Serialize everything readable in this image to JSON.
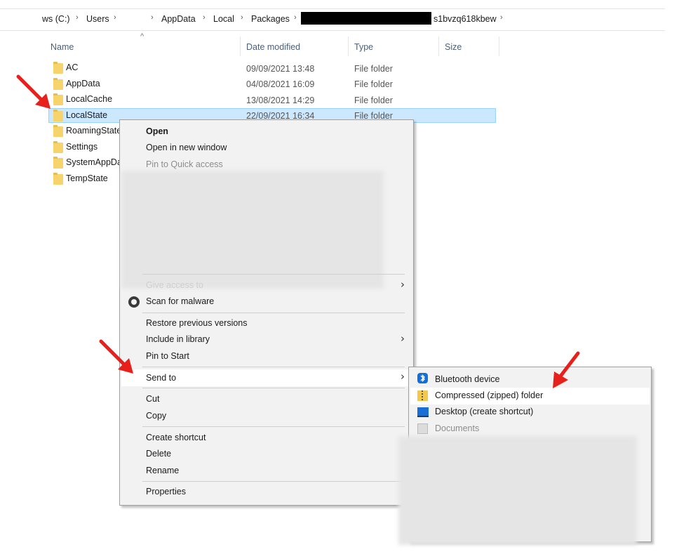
{
  "breadcrumb": {
    "items": [
      "ws (C:)",
      "Users",
      "AppData",
      "Local",
      "Packages",
      "s1bvzq618kbew"
    ],
    "separator": "›",
    "redacted_segment": true
  },
  "columns": {
    "name": "Name",
    "date_modified": "Date modified",
    "type": "Type",
    "size": "Size"
  },
  "files": [
    {
      "name": "AC",
      "date": "09/09/2021 13:48",
      "type": "File folder"
    },
    {
      "name": "AppData",
      "date": "04/08/2021 16:09",
      "type": "File folder"
    },
    {
      "name": "LocalCache",
      "date": "13/08/2021 14:29",
      "type": "File folder"
    },
    {
      "name": "LocalState",
      "date": "22/09/2021 16:34",
      "type": "File folder",
      "selected": true
    },
    {
      "name": "RoamingState",
      "date": "",
      "type": ""
    },
    {
      "name": "Settings",
      "date": "",
      "type": ""
    },
    {
      "name": "SystemAppData",
      "date": "",
      "type": ""
    },
    {
      "name": "TempState",
      "date": "",
      "type": ""
    }
  ],
  "context_menu": {
    "open": "Open",
    "open_new_window": "Open in new window",
    "pin_quick_access": "Pin to Quick access",
    "give_access": "Give access to",
    "scan_malware": "Scan for malware",
    "restore_versions": "Restore previous versions",
    "include_library": "Include in library",
    "pin_start": "Pin to Start",
    "send_to": "Send to",
    "cut": "Cut",
    "copy": "Copy",
    "create_shortcut": "Create shortcut",
    "delete": "Delete",
    "rename": "Rename",
    "properties": "Properties"
  },
  "send_to_menu": {
    "bluetooth": "Bluetooth device",
    "compressed": "Compressed (zipped) folder",
    "desktop": "Desktop (create shortcut)",
    "documents": "Documents"
  },
  "colors": {
    "selection": "#cce8ff",
    "menu_bg": "#f2f2f2",
    "annotation_arrow": "#e8201c",
    "folder": "#f6d36b"
  }
}
